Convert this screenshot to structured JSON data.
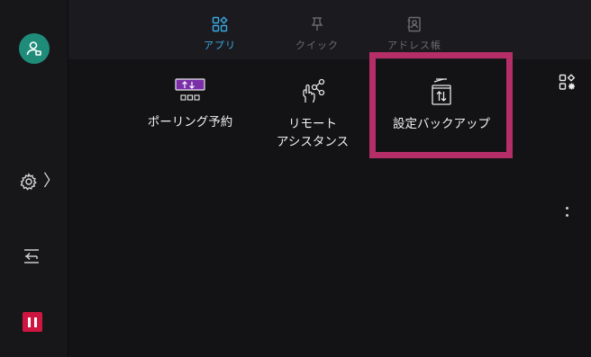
{
  "tabs": [
    {
      "label": "アプリ",
      "icon": "apps-grid-icon",
      "active": true
    },
    {
      "label": "クイック",
      "icon": "pin-icon",
      "active": false
    },
    {
      "label": "アドレス帳",
      "icon": "address-book-icon",
      "active": false
    }
  ],
  "apps": [
    {
      "label": "ポーリング予約",
      "icon": "polling-reservation-icon"
    },
    {
      "label": "リモート\nアシスタンス",
      "icon": "remote-assistance-icon"
    },
    {
      "label": "設定バックアップ",
      "icon": "settings-backup-icon"
    }
  ],
  "rail": {
    "avatar_icon": "user-login-icon",
    "settings_icon": "gear-icon",
    "settings_chevron": "〉",
    "job_icon": "job-flow-icon",
    "stop_icon": "stop-icon"
  },
  "colors": {
    "accent": "#39a9e3",
    "highlight": "#b52e68",
    "stop": "#cf1640",
    "avatar": "#1f8c79",
    "app_icon_purple": "#7a2ea8"
  }
}
